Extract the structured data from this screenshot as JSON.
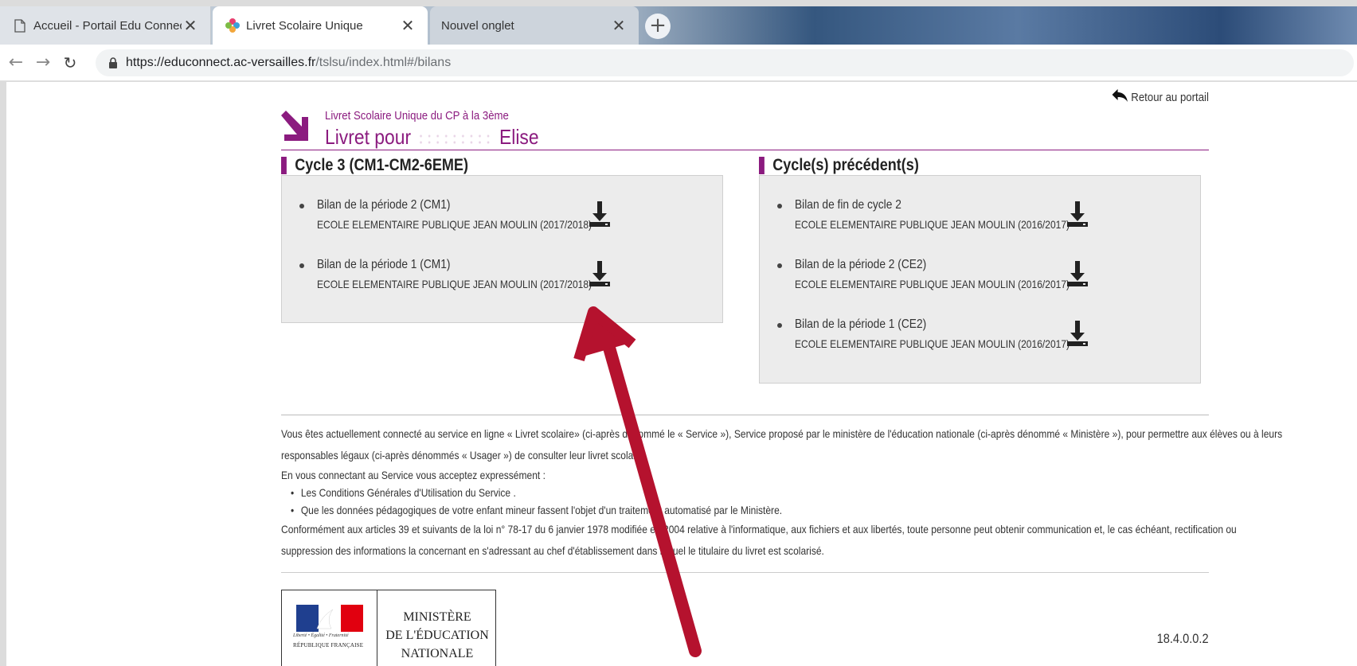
{
  "browser": {
    "tabs": [
      {
        "title": "Accueil - Portail Edu Connect",
        "icon": "page-icon",
        "active": false
      },
      {
        "title": "Livret Scolaire Unique",
        "icon": "colorful-petals-icon",
        "active": true
      },
      {
        "title": "Nouvel onglet",
        "icon": "",
        "active": false
      }
    ],
    "new_tab_label": "+",
    "close_label": "✕",
    "url_host": "https://educonnect.ac-versailles.fr",
    "url_path": "/tslsu/index.html#/bilans"
  },
  "page": {
    "back_link": "Retour au portail",
    "subtitle": "Livret Scolaire Unique du CP à la 3ème",
    "title_prefix": "Livret pour",
    "title_name": "Elise",
    "accent_color": "#8b1b7f",
    "current_cycle": {
      "heading": "Cycle 3 (CM1-CM2-6EME)",
      "items": [
        {
          "title": "Bilan de la période 2 (CM1)",
          "school": "ECOLE ELEMENTAIRE PUBLIQUE JEAN MOULIN (2017/2018)"
        },
        {
          "title": "Bilan de la période 1 (CM1)",
          "school": "ECOLE ELEMENTAIRE PUBLIQUE JEAN MOULIN (2017/2018)"
        }
      ]
    },
    "previous_cycles": {
      "heading": "Cycle(s) précédent(s)",
      "items": [
        {
          "title": "Bilan de fin de cycle 2",
          "school": "ECOLE ELEMENTAIRE PUBLIQUE JEAN MOULIN (2016/2017)"
        },
        {
          "title": "Bilan de la période 2 (CE2)",
          "school": "ECOLE ELEMENTAIRE PUBLIQUE JEAN MOULIN (2016/2017)"
        },
        {
          "title": "Bilan de la période 1 (CE2)",
          "school": "ECOLE ELEMENTAIRE PUBLIQUE JEAN MOULIN (2016/2017)"
        }
      ]
    },
    "legal": {
      "line1": "Vous êtes actuellement connecté au service en ligne « Livret scolaire» (ci-après dénommé le « Service »), Service proposé par le ministère de l'éducation nationale (ci-après dénommé « Ministère »), pour permettre aux élèves ou à leurs",
      "line2": "responsables légaux (ci-après dénommés « Usager ») de consulter leur livret scolaire.",
      "line3": "En vous connectant au Service vous acceptez expressément :",
      "bullets": [
        "Les Conditions Générales d'Utilisation du Service .",
        "Que les données pédagogiques de votre enfant mineur fassent l'objet d'un traitement automatisé par le Ministère."
      ],
      "line4": "Conformément aux articles 39 et suivants de la loi n° 78-17 du 6 janvier 1978 modifiée en 2004 relative à l'informatique, aux fichiers et aux libertés, toute personne peut obtenir communication et, le cas échéant, rectification ou",
      "line5": "suppression des informations la concernant en s'adressant au chef d'établissement dans lequel le titulaire du livret est scolarisé."
    },
    "ministere": {
      "line1": "MINISTÈRE",
      "line2": "DE L'ÉDUCATION",
      "line3": "NATIONALE",
      "motto": "Liberté • Égalité • Fraternité",
      "republic": "RÉPUBLIQUE FRANÇAISE"
    },
    "version": "18.4.0.0.2"
  },
  "annotation": {
    "arrow_color": "#b5122e"
  }
}
